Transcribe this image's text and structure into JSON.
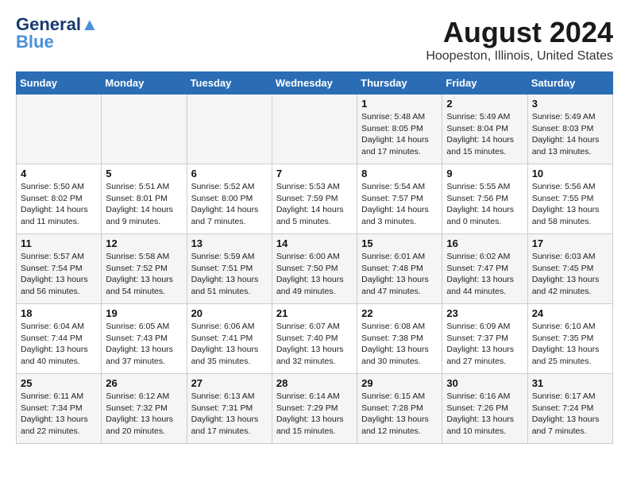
{
  "header": {
    "logo_line1": "General",
    "logo_line2": "Blue",
    "main_title": "August 2024",
    "subtitle": "Hoopeston, Illinois, United States"
  },
  "calendar": {
    "days_of_week": [
      "Sunday",
      "Monday",
      "Tuesday",
      "Wednesday",
      "Thursday",
      "Friday",
      "Saturday"
    ],
    "weeks": [
      [
        {
          "day": "",
          "info": ""
        },
        {
          "day": "",
          "info": ""
        },
        {
          "day": "",
          "info": ""
        },
        {
          "day": "",
          "info": ""
        },
        {
          "day": "1",
          "info": "Sunrise: 5:48 AM\nSunset: 8:05 PM\nDaylight: 14 hours\nand 17 minutes."
        },
        {
          "day": "2",
          "info": "Sunrise: 5:49 AM\nSunset: 8:04 PM\nDaylight: 14 hours\nand 15 minutes."
        },
        {
          "day": "3",
          "info": "Sunrise: 5:49 AM\nSunset: 8:03 PM\nDaylight: 14 hours\nand 13 minutes."
        }
      ],
      [
        {
          "day": "4",
          "info": "Sunrise: 5:50 AM\nSunset: 8:02 PM\nDaylight: 14 hours\nand 11 minutes."
        },
        {
          "day": "5",
          "info": "Sunrise: 5:51 AM\nSunset: 8:01 PM\nDaylight: 14 hours\nand 9 minutes."
        },
        {
          "day": "6",
          "info": "Sunrise: 5:52 AM\nSunset: 8:00 PM\nDaylight: 14 hours\nand 7 minutes."
        },
        {
          "day": "7",
          "info": "Sunrise: 5:53 AM\nSunset: 7:59 PM\nDaylight: 14 hours\nand 5 minutes."
        },
        {
          "day": "8",
          "info": "Sunrise: 5:54 AM\nSunset: 7:57 PM\nDaylight: 14 hours\nand 3 minutes."
        },
        {
          "day": "9",
          "info": "Sunrise: 5:55 AM\nSunset: 7:56 PM\nDaylight: 14 hours\nand 0 minutes."
        },
        {
          "day": "10",
          "info": "Sunrise: 5:56 AM\nSunset: 7:55 PM\nDaylight: 13 hours\nand 58 minutes."
        }
      ],
      [
        {
          "day": "11",
          "info": "Sunrise: 5:57 AM\nSunset: 7:54 PM\nDaylight: 13 hours\nand 56 minutes."
        },
        {
          "day": "12",
          "info": "Sunrise: 5:58 AM\nSunset: 7:52 PM\nDaylight: 13 hours\nand 54 minutes."
        },
        {
          "day": "13",
          "info": "Sunrise: 5:59 AM\nSunset: 7:51 PM\nDaylight: 13 hours\nand 51 minutes."
        },
        {
          "day": "14",
          "info": "Sunrise: 6:00 AM\nSunset: 7:50 PM\nDaylight: 13 hours\nand 49 minutes."
        },
        {
          "day": "15",
          "info": "Sunrise: 6:01 AM\nSunset: 7:48 PM\nDaylight: 13 hours\nand 47 minutes."
        },
        {
          "day": "16",
          "info": "Sunrise: 6:02 AM\nSunset: 7:47 PM\nDaylight: 13 hours\nand 44 minutes."
        },
        {
          "day": "17",
          "info": "Sunrise: 6:03 AM\nSunset: 7:45 PM\nDaylight: 13 hours\nand 42 minutes."
        }
      ],
      [
        {
          "day": "18",
          "info": "Sunrise: 6:04 AM\nSunset: 7:44 PM\nDaylight: 13 hours\nand 40 minutes."
        },
        {
          "day": "19",
          "info": "Sunrise: 6:05 AM\nSunset: 7:43 PM\nDaylight: 13 hours\nand 37 minutes."
        },
        {
          "day": "20",
          "info": "Sunrise: 6:06 AM\nSunset: 7:41 PM\nDaylight: 13 hours\nand 35 minutes."
        },
        {
          "day": "21",
          "info": "Sunrise: 6:07 AM\nSunset: 7:40 PM\nDaylight: 13 hours\nand 32 minutes."
        },
        {
          "day": "22",
          "info": "Sunrise: 6:08 AM\nSunset: 7:38 PM\nDaylight: 13 hours\nand 30 minutes."
        },
        {
          "day": "23",
          "info": "Sunrise: 6:09 AM\nSunset: 7:37 PM\nDaylight: 13 hours\nand 27 minutes."
        },
        {
          "day": "24",
          "info": "Sunrise: 6:10 AM\nSunset: 7:35 PM\nDaylight: 13 hours\nand 25 minutes."
        }
      ],
      [
        {
          "day": "25",
          "info": "Sunrise: 6:11 AM\nSunset: 7:34 PM\nDaylight: 13 hours\nand 22 minutes."
        },
        {
          "day": "26",
          "info": "Sunrise: 6:12 AM\nSunset: 7:32 PM\nDaylight: 13 hours\nand 20 minutes."
        },
        {
          "day": "27",
          "info": "Sunrise: 6:13 AM\nSunset: 7:31 PM\nDaylight: 13 hours\nand 17 minutes."
        },
        {
          "day": "28",
          "info": "Sunrise: 6:14 AM\nSunset: 7:29 PM\nDaylight: 13 hours\nand 15 minutes."
        },
        {
          "day": "29",
          "info": "Sunrise: 6:15 AM\nSunset: 7:28 PM\nDaylight: 13 hours\nand 12 minutes."
        },
        {
          "day": "30",
          "info": "Sunrise: 6:16 AM\nSunset: 7:26 PM\nDaylight: 13 hours\nand 10 minutes."
        },
        {
          "day": "31",
          "info": "Sunrise: 6:17 AM\nSunset: 7:24 PM\nDaylight: 13 hours\nand 7 minutes."
        }
      ]
    ]
  }
}
